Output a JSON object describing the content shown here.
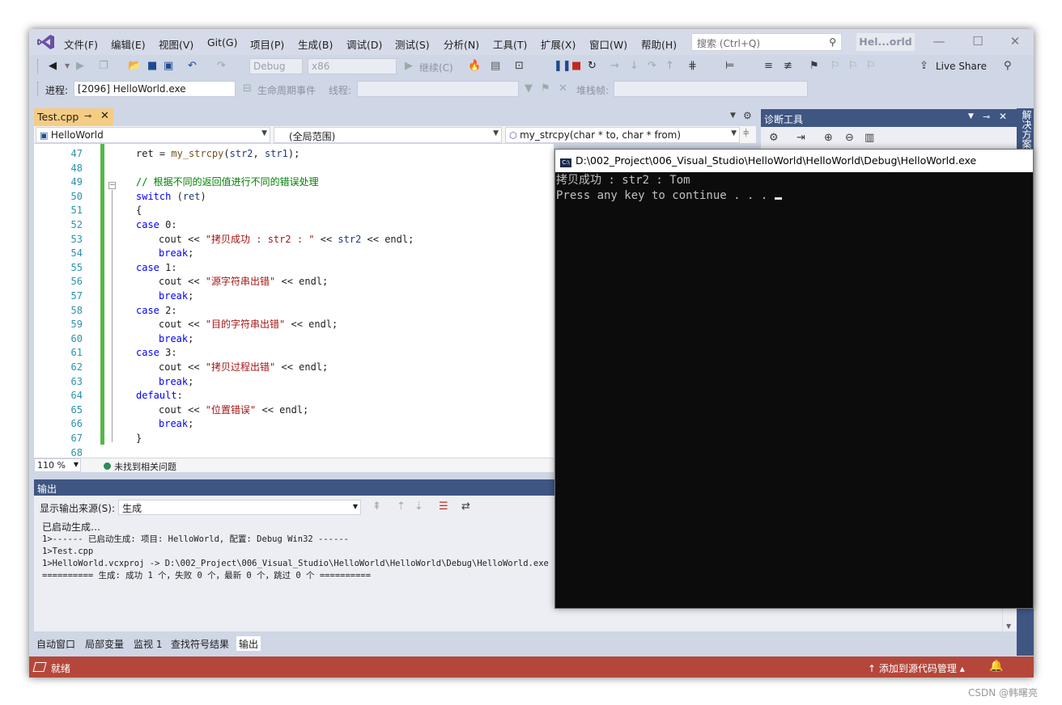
{
  "menubar": {
    "items": [
      "文件(F)",
      "编辑(E)",
      "视图(V)",
      "Git(G)",
      "项目(P)",
      "生成(B)",
      "调试(D)",
      "测试(S)",
      "分析(N)",
      "工具(T)",
      "扩展(X)",
      "窗口(W)",
      "帮助(H)"
    ],
    "search_placeholder": "搜索 (Ctrl+Q)",
    "solution_badge": "Hel...orld",
    "minimize": "—",
    "maximize": "☐",
    "close": "✕"
  },
  "toolbar1": {
    "config": "Debug",
    "platform": "x86",
    "continue_label": "继续(C)",
    "live_share": "Live Share"
  },
  "toolbar2": {
    "process_label": "进程:",
    "process_value": "[2096] HelloWorld.exe",
    "lifecycle_label": "生命周期事件",
    "thread_label": "线程:",
    "stackframe_label": "堆栈帧:"
  },
  "editor": {
    "tab_label": "Test.cpp",
    "nav_project": "HelloWorld",
    "nav_scope": "(全局范围)",
    "nav_member": "my_strcpy(char * to, char * from)",
    "zoom": "110 %",
    "issues": "未找到相关问题"
  },
  "code_lines": [
    {
      "n": "47",
      "html": "ret = <span class='fn'>my_strcpy</span>(<span class='var'>str2</span>, <span class='var'>str1</span>);",
      "indent": 0
    },
    {
      "n": "48",
      "html": "",
      "indent": 0
    },
    {
      "n": "49",
      "html": "<span class='cmt'>// 根据不同的返回值进行不同的错误处理</span>",
      "indent": 0
    },
    {
      "n": "50",
      "html": "<span class='kw'>switch</span> (<span class='var'>ret</span>)",
      "indent": 0
    },
    {
      "n": "51",
      "html": "{",
      "indent": 0
    },
    {
      "n": "52",
      "html": "<span class='kw'>case</span> 0:",
      "indent": 0
    },
    {
      "n": "53",
      "html": "cout &lt;&lt; <span class='str'>\"拷贝成功 : str2 : \"</span> &lt;&lt; <span class='var'>str2</span> &lt;&lt; endl;",
      "indent": 1
    },
    {
      "n": "54",
      "html": "<span class='kw'>break</span>;",
      "indent": 1
    },
    {
      "n": "55",
      "html": "<span class='kw'>case</span> 1:",
      "indent": 0
    },
    {
      "n": "56",
      "html": "cout &lt;&lt; <span class='str'>\"源字符串出错\"</span> &lt;&lt; endl;",
      "indent": 1
    },
    {
      "n": "57",
      "html": "<span class='kw'>break</span>;",
      "indent": 1
    },
    {
      "n": "58",
      "html": "<span class='kw'>case</span> 2:",
      "indent": 0
    },
    {
      "n": "59",
      "html": "cout &lt;&lt; <span class='str'>\"目的字符串出错\"</span> &lt;&lt; endl;",
      "indent": 1
    },
    {
      "n": "60",
      "html": "<span class='kw'>break</span>;",
      "indent": 1
    },
    {
      "n": "61",
      "html": "<span class='kw'>case</span> 3:",
      "indent": 0
    },
    {
      "n": "62",
      "html": "cout &lt;&lt; <span class='str'>\"拷贝过程出错\"</span> &lt;&lt; endl;",
      "indent": 1
    },
    {
      "n": "63",
      "html": "<span class='kw'>break</span>;",
      "indent": 1
    },
    {
      "n": "64",
      "html": "<span class='kw'>default</span>:",
      "indent": 0
    },
    {
      "n": "65",
      "html": "cout &lt;&lt; <span class='str'>\"位置错误\"</span> &lt;&lt; endl;",
      "indent": 1
    },
    {
      "n": "66",
      "html": "<span class='kw'>break</span>;",
      "indent": 1
    },
    {
      "n": "67",
      "html": "}",
      "indent": 0
    },
    {
      "n": "68",
      "html": "",
      "indent": 0
    }
  ],
  "output": {
    "title": "输出",
    "source_label": "显示输出来源(S):",
    "source_value": "生成",
    "lines": [
      "已启动生成…",
      "1>------ 已启动生成: 项目: HelloWorld, 配置: Debug Win32 ------",
      "1>Test.cpp",
      "1>HelloWorld.vcxproj -> D:\\002_Project\\006_Visual_Studio\\HelloWorld\\HelloWorld\\Debug\\HelloWorld.exe",
      "========== 生成: 成功 1 个，失败 0 个，最新 0 个，跳过 0 个 =========="
    ]
  },
  "bottom_tabs": [
    "自动窗口",
    "局部变量",
    "监视 1",
    "查找符号结果",
    "输出"
  ],
  "statusbar": {
    "ready": "就绪",
    "source_control": "添加到源代码管理"
  },
  "diagnostics": {
    "title": "诊断工具"
  },
  "side_strip": "解决方案",
  "console": {
    "title": "D:\\002_Project\\006_Visual_Studio\\HelloWorld\\HelloWorld\\Debug\\HelloWorld.exe",
    "line1": "拷贝成功 : str2 : Tom",
    "line2": "Press any key to continue . . . "
  },
  "watermark": "CSDN @韩曙亮",
  "colors": {
    "accent": "#3f5683",
    "status_bar": "#b5473a",
    "tab_active": "#f5cc84",
    "change_bar": "#57b74a"
  }
}
